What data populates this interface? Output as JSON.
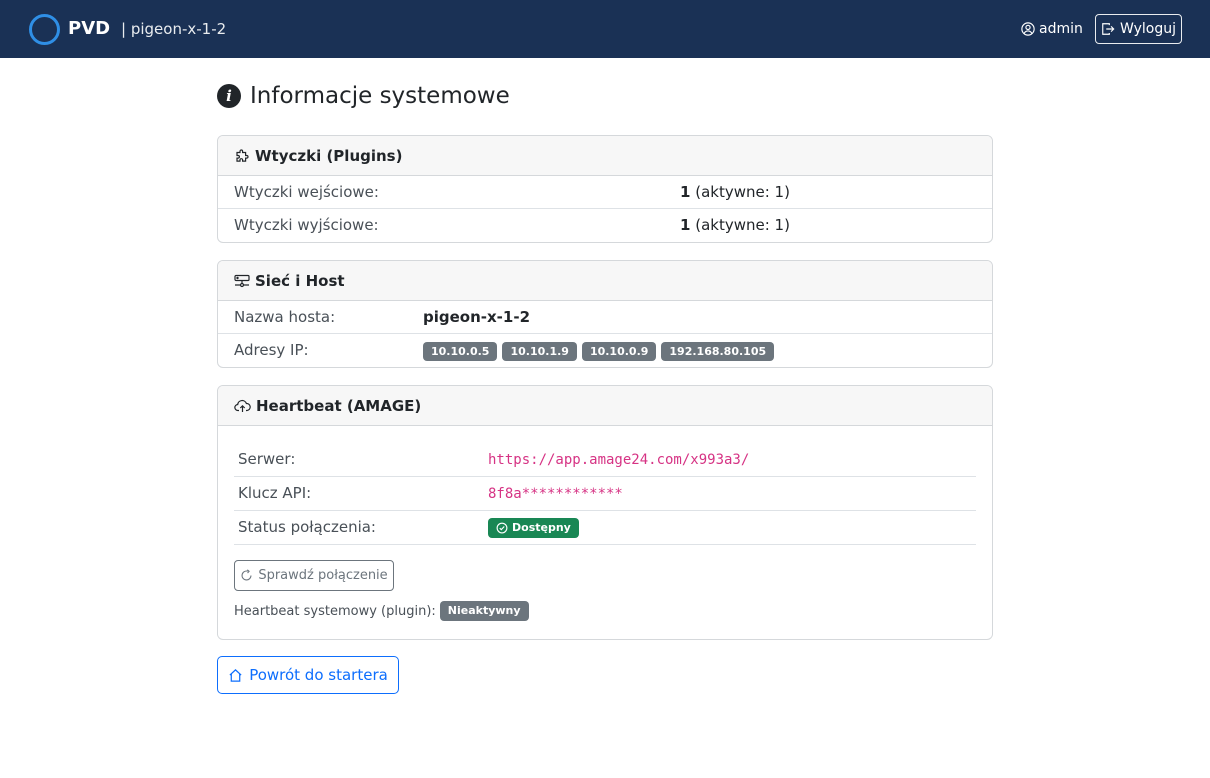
{
  "navbar": {
    "brand": "PVD",
    "host": "| pigeon-x-1-2",
    "user": "admin",
    "logout_label": "Wyloguj"
  },
  "page": {
    "title": "Informacje systemowe"
  },
  "plugins_card": {
    "title": "Wtyczki (Plugins)",
    "rows": [
      {
        "label": "Wtyczki wejściowe:",
        "count": "1",
        "active": "(aktywne: 1)"
      },
      {
        "label": "Wtyczki wyjściowe:",
        "count": "1",
        "active": "(aktywne: 1)"
      }
    ]
  },
  "network_card": {
    "title": "Sieć i Host",
    "hostname_label": "Nazwa hosta:",
    "hostname": "pigeon-x-1-2",
    "ips_label": "Adresy IP:",
    "ips": [
      "10.10.0.5",
      "10.10.1.9",
      "10.10.0.9",
      "192.168.80.105"
    ]
  },
  "heartbeat_card": {
    "title": "Heartbeat (AMAGE)",
    "server_label": "Serwer:",
    "server": "https://app.amage24.com/x993a3/",
    "api_key_label": "Klucz API:",
    "api_key": "8f8a************",
    "status_label": "Status połączenia:",
    "status": "Dostępny",
    "check_button": "Sprawdź połączenie",
    "plugin_label": "Heartbeat systemowy (plugin):",
    "plugin_status": "Nieaktywny"
  },
  "footer": {
    "back_button": "Powrót do startera"
  },
  "colors": {
    "navbar_bg": "#1a3155",
    "logo_ring": "#2f8fe6",
    "success": "#198754",
    "secondary": "#6c757d",
    "primary": "#0d6efd",
    "code": "#d63384"
  },
  "icons": {
    "title": "info-circle-icon",
    "user": "person-circle-icon",
    "logout": "box-arrow-right-icon",
    "plugins": "puzzle-icon",
    "network": "hdd-network-icon",
    "heartbeat": "cloud-upload-icon",
    "status": "check-circle-icon",
    "check": "arrow-clockwise-icon",
    "back": "house-icon"
  }
}
